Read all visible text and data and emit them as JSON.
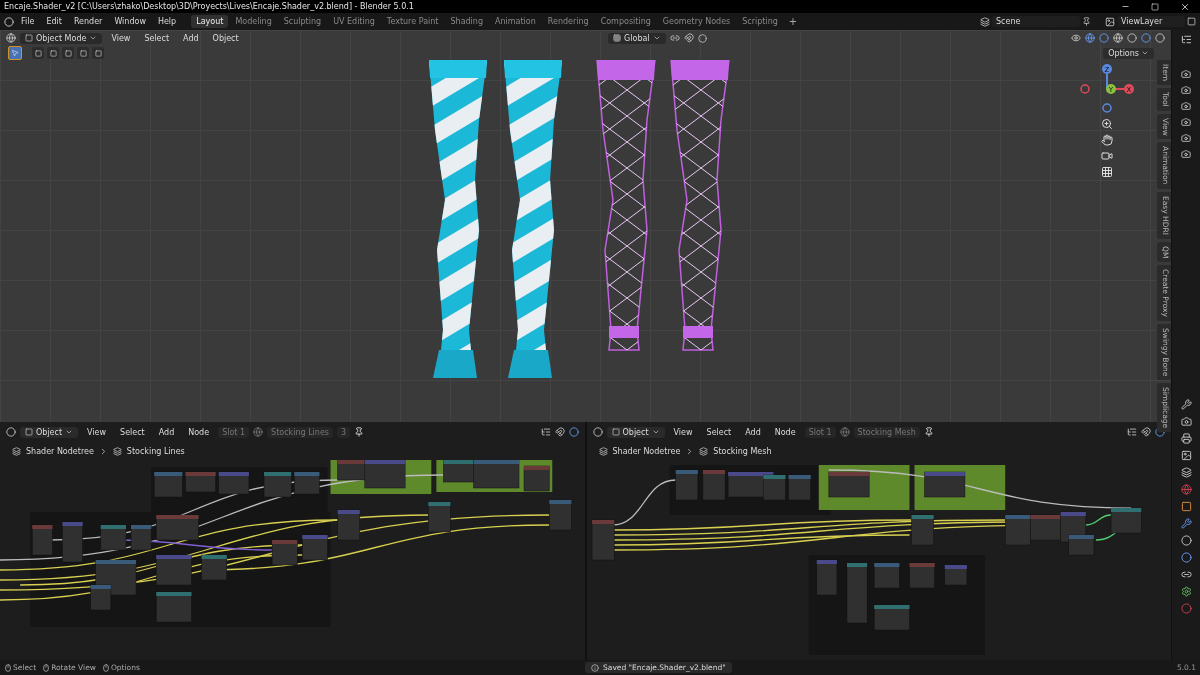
{
  "window": {
    "title": "Encaje.Shader_v2 [C:\\Users\\zhako\\Desktop\\3D\\Proyects\\Lives\\Encaje.Shader_v2.blend] - Blender 5.0.1"
  },
  "menu": [
    "File",
    "Edit",
    "Render",
    "Window",
    "Help"
  ],
  "workspaces": [
    {
      "label": "Layout",
      "selected": true
    },
    {
      "label": "Modeling",
      "selected": false
    },
    {
      "label": "Sculpting",
      "selected": false
    },
    {
      "label": "UV Editing",
      "selected": false
    },
    {
      "label": "Texture Paint",
      "selected": false
    },
    {
      "label": "Shading",
      "selected": false
    },
    {
      "label": "Animation",
      "selected": false
    },
    {
      "label": "Rendering",
      "selected": false
    },
    {
      "label": "Compositing",
      "selected": false
    },
    {
      "label": "Geometry Nodes",
      "selected": false
    },
    {
      "label": "Scripting",
      "selected": false
    }
  ],
  "add_workspace": "+",
  "scene": "Scene",
  "view_layer": "ViewLayer",
  "viewport": {
    "mode": "Object Mode",
    "menus": [
      "View",
      "Select",
      "Add",
      "Object"
    ],
    "orientation": "Global",
    "options": "Options",
    "gizmo_axes": [
      "X",
      "Y",
      "Z"
    ],
    "sidebar_tabs": [
      "Item",
      "Tool",
      "View",
      "Animation",
      "Easy HDRI",
      "QM",
      "Create Proxy",
      "Swingy Bone",
      "Simplicage"
    ]
  },
  "node_editors": [
    {
      "object": "Object",
      "menus": [
        "View",
        "Select",
        "Add",
        "Node"
      ],
      "slot": "Slot 1",
      "material": "Stocking Lines",
      "users": "3",
      "breadcrumb": [
        "Shader Nodetree",
        "Stocking Lines"
      ]
    },
    {
      "object": "Object",
      "menus": [
        "View",
        "Select",
        "Add",
        "Node"
      ],
      "slot": "Slot 1",
      "material": "Stocking Mesh",
      "breadcrumb": [
        "Shader Nodetree",
        "Stocking Mesh"
      ]
    }
  ],
  "status_bar": {
    "hints": [
      "Select",
      "Rotate View",
      "Options"
    ],
    "message": "Saved \"Encaje.Shader_v2.blend\"",
    "version": "5.0.1"
  }
}
